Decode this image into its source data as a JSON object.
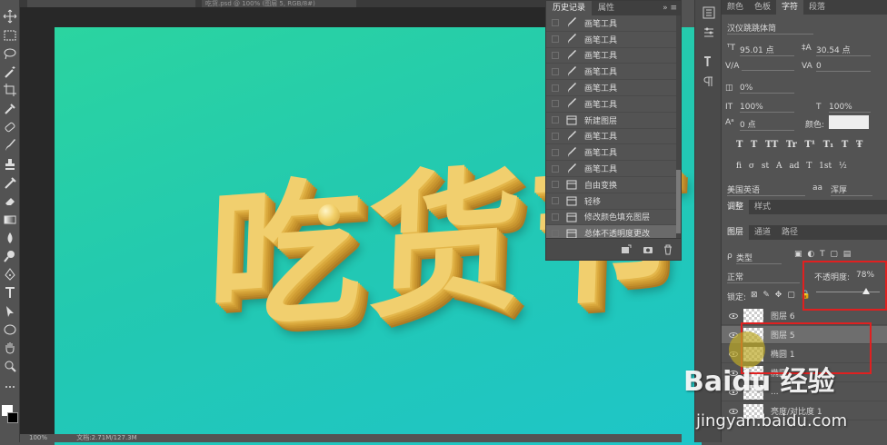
{
  "document_tabs": [
    "",
    "吃货.psd @ 100% (图层 5, RGB/8#)"
  ],
  "canvas_text": "吃货节",
  "status_bar": {
    "zoom": "100%",
    "doc_info": "文档:2.71M/127.3M"
  },
  "history_panel": {
    "tabs": [
      "历史记录",
      "属性"
    ],
    "menu": "»  ≡",
    "items": [
      {
        "label": "画笔工具",
        "icon": "brush-icon"
      },
      {
        "label": "画笔工具",
        "icon": "brush-icon"
      },
      {
        "label": "画笔工具",
        "icon": "brush-icon"
      },
      {
        "label": "画笔工具",
        "icon": "brush-icon"
      },
      {
        "label": "画笔工具",
        "icon": "brush-icon"
      },
      {
        "label": "画笔工具",
        "icon": "brush-icon"
      },
      {
        "label": "新建图层",
        "icon": "layer-icon"
      },
      {
        "label": "画笔工具",
        "icon": "brush-icon"
      },
      {
        "label": "画笔工具",
        "icon": "brush-icon"
      },
      {
        "label": "画笔工具",
        "icon": "brush-icon"
      },
      {
        "label": "自由变换",
        "icon": "layer-icon"
      },
      {
        "label": "轻移",
        "icon": "layer-icon"
      },
      {
        "label": "修改颜色填充图层",
        "icon": "layer-icon"
      },
      {
        "label": "总体不透明度更改",
        "icon": "layer-icon"
      }
    ]
  },
  "char_panel": {
    "tabs": [
      "颜色",
      "色板",
      "字符",
      "段落"
    ],
    "font_family": "汉仪跳跳体简",
    "font_size": "95.01 点",
    "leading": "30.54 点",
    "tracking": "0",
    "kerning_label": "V/A",
    "scale_percent": "0%",
    "vertical_scale": "100%",
    "horizontal_scale": "100%",
    "baseline_shift": "0 点",
    "color_label": "颜色:",
    "style_row1": "T T TT Tr T¹ T₁ T Ŧ",
    "style_row2": "fi σ st A ad T 1st ½",
    "language": "美国英语",
    "aa_icon": "aa",
    "antialias": "浑厚"
  },
  "adjust_tabs": [
    "调整",
    "样式"
  ],
  "layers_panel": {
    "tabs": [
      "图层",
      "通道",
      "路径"
    ],
    "filter_kind": "类型",
    "blend_mode": "正常",
    "opacity_label": "不透明度:",
    "opacity_value": "78%",
    "opacity_fraction": 0.78,
    "lock_label": "锁定:",
    "layers": [
      {
        "name": "图层 6",
        "selected": false
      },
      {
        "name": "图层 5",
        "selected": true
      },
      {
        "name": "椭圆 1",
        "selected": false
      },
      {
        "name": "椭圆",
        "selected": false
      },
      {
        "name": "...",
        "selected": false
      },
      {
        "name": "亮度/对比度 1",
        "selected": false
      }
    ]
  },
  "watermark": {
    "logo": "Baidu 经验",
    "url": "jingyan.baidu.com"
  }
}
